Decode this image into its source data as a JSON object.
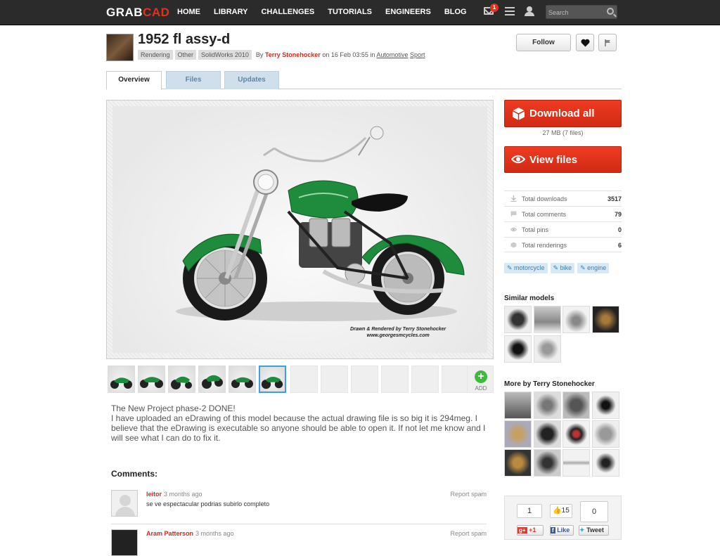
{
  "topnav": {
    "logo_part1": "GRAB",
    "logo_part2": "CAD",
    "items": [
      "HOME",
      "LIBRARY",
      "CHALLENGES",
      "TUTORIALS",
      "ENGINEERS",
      "BLOG"
    ],
    "notification_count": "1",
    "search_placeholder": "Search"
  },
  "model": {
    "title": "1952 fl assy-d",
    "tags": [
      "Rendering",
      "Other",
      "SolidWorks 2010"
    ],
    "by_prefix": "By",
    "author": "Terry Stonehocker",
    "posted": "on 16 Feb 03:55 in",
    "category1": "Automotive",
    "category2": "Sport",
    "follow_label": "Follow"
  },
  "tabs": [
    "Overview",
    "Files",
    "Updates"
  ],
  "image": {
    "credit_line1": "Drawn & Rendered  by Terry Stonehocker",
    "credit_line2": "www.georgesmcycles.com"
  },
  "gallery": {
    "add_label": "ADD"
  },
  "description": {
    "line1": "The New Project phase-2 DONE!",
    "body": "I have uploaded an eDrawing of this model because the actual drawing file is so big it is 294meg. I believe that the eDrawing is executable so anyone should be able to open it. If not let me know and I will see what I can do to fix it."
  },
  "comments": {
    "title": "Comments:",
    "report_label": "Report spam",
    "items": [
      {
        "author": "leitor",
        "time": "3 months ago",
        "text": "se ve espectacular podrias subirlo completo"
      },
      {
        "author": "Aram Patterson",
        "time": "3 months ago",
        "text": ""
      }
    ]
  },
  "sidebar": {
    "download_label": "Download all",
    "download_size": "27 MB (7 files)",
    "view_files_label": "View files",
    "stats": [
      {
        "label": "Total downloads",
        "value": "3517",
        "icon": "download-icon"
      },
      {
        "label": "Total comments",
        "value": "79",
        "icon": "comment-icon"
      },
      {
        "label": "Total pins",
        "value": "0",
        "icon": "eye-icon"
      },
      {
        "label": "Total renderings",
        "value": "6",
        "icon": "cube-icon"
      }
    ],
    "keywords": [
      "motorcycle",
      "bike",
      "engine"
    ],
    "similar_title": "Similar models",
    "more_by_title": "More by Terry Stonehocker"
  },
  "social": {
    "gplus_count": "1",
    "fb_count": "15",
    "tweet_count": "0",
    "gplus_label": "+1",
    "fb_label": "Like",
    "tweet_label": "Tweet"
  },
  "colors": {
    "brand_red": "#e3311e",
    "topbar": "#2b2b2b",
    "author_red": "#d52b1e",
    "tab_inactive": "#cfe0ec",
    "selected_thumb": "#3aa0e0"
  }
}
